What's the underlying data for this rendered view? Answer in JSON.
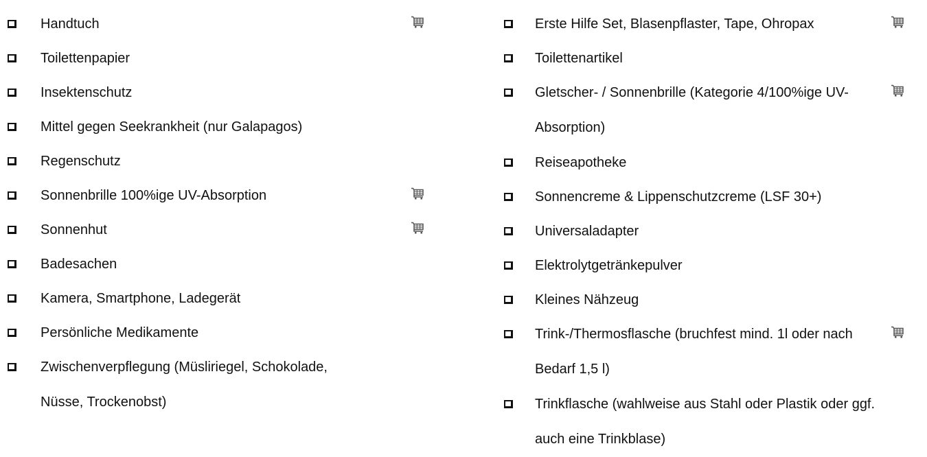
{
  "left_items": [
    {
      "label": "Handtuch",
      "cart": true
    },
    {
      "label": "Toilettenpapier",
      "cart": false
    },
    {
      "label": "Insektenschutz",
      "cart": false
    },
    {
      "label": "Mittel gegen Seekrankheit (nur Galapagos)",
      "cart": false
    },
    {
      "label": "Regenschutz",
      "cart": false
    },
    {
      "label": "Sonnenbrille 100%ige UV-Absorption",
      "cart": true
    },
    {
      "label": "Sonnenhut",
      "cart": true
    },
    {
      "label": "Badesachen",
      "cart": false
    },
    {
      "label": "Kamera, Smartphone, Ladegerät",
      "cart": false
    },
    {
      "label": "Persönliche Medikamente",
      "cart": false
    },
    {
      "label": "Zwischenverpflegung (Müsliriegel, Schokolade, Nüsse, Trockenobst)",
      "cart": false
    }
  ],
  "right_items": [
    {
      "label": "Erste Hilfe Set, Blasenpflaster, Tape, Ohropax",
      "cart": true
    },
    {
      "label": "Toilettenartikel",
      "cart": false
    },
    {
      "label": "Gletscher- / Sonnenbrille (Kategorie 4/100%ige UV-Absorption)",
      "cart": true
    },
    {
      "label": "Reiseapotheke",
      "cart": false
    },
    {
      "label": "Sonnencreme & Lippenschutzcreme (LSF 30+)",
      "cart": false
    },
    {
      "label": "Universaladapter",
      "cart": false
    },
    {
      "label": "Elektrolytgetränkepulver",
      "cart": false
    },
    {
      "label": "Kleines Nähzeug",
      "cart": false
    },
    {
      "label": "Trink-/Thermosflasche (bruchfest mind. 1l oder nach Bedarf 1,5 l)",
      "cart": true
    },
    {
      "label": "Trinkflasche (wahlweise aus Stahl oder Plastik oder ggf. auch eine Trinkblase)",
      "cart": false
    }
  ],
  "icons": {
    "checkbox": "checkbox-icon",
    "cart": "shopping-cart-icon"
  },
  "colors": {
    "text": "#111111",
    "cart": "#555555"
  }
}
